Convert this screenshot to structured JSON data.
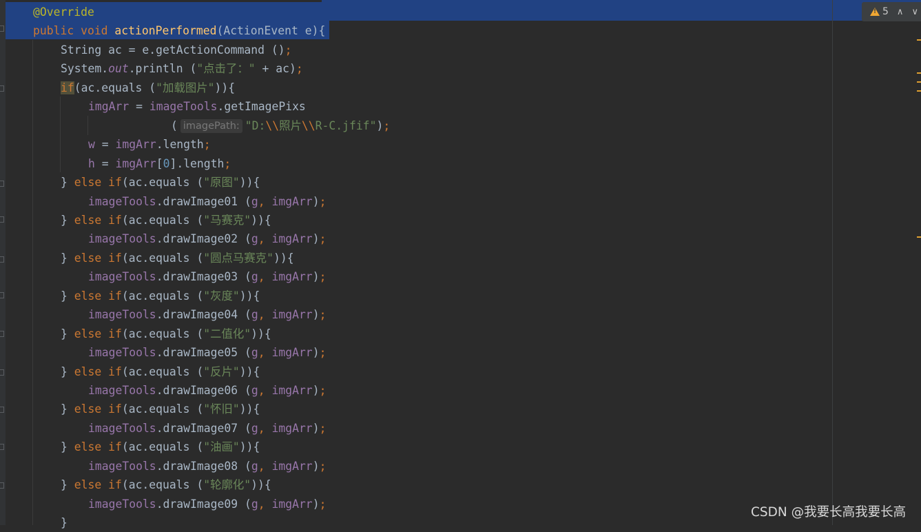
{
  "editor": {
    "lines": [
      {
        "indent": 0,
        "tokens": [
          {
            "t": "@Override",
            "c": "ann"
          }
        ]
      },
      {
        "indent": 0,
        "tokens": [
          {
            "t": "public ",
            "c": "kw"
          },
          {
            "t": "void ",
            "c": "kw"
          },
          {
            "t": "actionPerformed",
            "c": "fn"
          },
          {
            "t": "(ActionEvent e){",
            "c": ""
          }
        ]
      },
      {
        "indent": 1,
        "tokens": [
          {
            "t": "String ac = e.getActionCommand ()",
            "c": ""
          },
          {
            "t": ";",
            "c": "punc"
          }
        ]
      },
      {
        "indent": 1,
        "tokens": [
          {
            "t": "System.",
            "c": ""
          },
          {
            "t": "out",
            "c": "static"
          },
          {
            "t": ".println (",
            "c": ""
          },
          {
            "t": "\"点击了：\"",
            "c": "str"
          },
          {
            "t": " + ac)",
            "c": ""
          },
          {
            "t": ";",
            "c": "punc"
          }
        ]
      },
      {
        "indent": 1,
        "tokens": [
          {
            "t": "if",
            "c": "kw hl"
          },
          {
            "t": "(ac.equals (",
            "c": ""
          },
          {
            "t": "\"加载图片\"",
            "c": "str"
          },
          {
            "t": ")){",
            "c": ""
          }
        ]
      },
      {
        "indent": 2,
        "tokens": [
          {
            "t": "imgArr",
            "c": "field"
          },
          {
            "t": " = ",
            "c": ""
          },
          {
            "t": "imageTools",
            "c": "field"
          },
          {
            "t": ".getImagePixs",
            "c": ""
          }
        ]
      },
      {
        "indent": 5,
        "tokens": [
          {
            "t": "(",
            "c": ""
          },
          {
            "t": "imagePath:",
            "c": "hint"
          },
          {
            "t": "\"D:",
            "c": "str"
          },
          {
            "t": "\\\\",
            "c": "esc"
          },
          {
            "t": "照片",
            "c": "str"
          },
          {
            "t": "\\\\",
            "c": "esc"
          },
          {
            "t": "R-C.jfif\"",
            "c": "str"
          },
          {
            "t": ")",
            "c": ""
          },
          {
            "t": ";",
            "c": "punc"
          }
        ]
      },
      {
        "indent": 2,
        "tokens": [
          {
            "t": "w",
            "c": "field"
          },
          {
            "t": " = ",
            "c": ""
          },
          {
            "t": "imgArr",
            "c": "field"
          },
          {
            "t": ".length",
            "c": ""
          },
          {
            "t": ";",
            "c": "punc"
          }
        ]
      },
      {
        "indent": 2,
        "tokens": [
          {
            "t": "h",
            "c": "field"
          },
          {
            "t": " = ",
            "c": ""
          },
          {
            "t": "imgArr",
            "c": "field"
          },
          {
            "t": "[",
            "c": ""
          },
          {
            "t": "0",
            "c": "num"
          },
          {
            "t": "].length",
            "c": ""
          },
          {
            "t": ";",
            "c": "punc"
          }
        ]
      },
      {
        "indent": 1,
        "tokens": [
          {
            "t": "} ",
            "c": ""
          },
          {
            "t": "else if",
            "c": "kw"
          },
          {
            "t": "(ac.equals (",
            "c": ""
          },
          {
            "t": "\"原图\"",
            "c": "str"
          },
          {
            "t": ")){",
            "c": ""
          }
        ]
      },
      {
        "indent": 2,
        "tokens": [
          {
            "t": "imageTools",
            "c": "field"
          },
          {
            "t": ".drawImage01 (",
            "c": ""
          },
          {
            "t": "g",
            "c": "field"
          },
          {
            "t": ", ",
            "c": "punc"
          },
          {
            "t": "imgArr",
            "c": "field"
          },
          {
            "t": ")",
            "c": ""
          },
          {
            "t": ";",
            "c": "punc"
          }
        ]
      },
      {
        "indent": 1,
        "tokens": [
          {
            "t": "} ",
            "c": ""
          },
          {
            "t": "else if",
            "c": "kw"
          },
          {
            "t": "(ac.equals (",
            "c": ""
          },
          {
            "t": "\"马赛克\"",
            "c": "str"
          },
          {
            "t": ")){",
            "c": ""
          }
        ]
      },
      {
        "indent": 2,
        "tokens": [
          {
            "t": "imageTools",
            "c": "field"
          },
          {
            "t": ".drawImage02 (",
            "c": ""
          },
          {
            "t": "g",
            "c": "field"
          },
          {
            "t": ", ",
            "c": "punc"
          },
          {
            "t": "imgArr",
            "c": "field"
          },
          {
            "t": ")",
            "c": ""
          },
          {
            "t": ";",
            "c": "punc"
          }
        ]
      },
      {
        "indent": 1,
        "tokens": [
          {
            "t": "} ",
            "c": ""
          },
          {
            "t": "else if",
            "c": "kw"
          },
          {
            "t": "(ac.equals (",
            "c": ""
          },
          {
            "t": "\"圆点马赛克\"",
            "c": "str"
          },
          {
            "t": ")){",
            "c": ""
          }
        ]
      },
      {
        "indent": 2,
        "tokens": [
          {
            "t": "imageTools",
            "c": "field"
          },
          {
            "t": ".drawImage03 (",
            "c": ""
          },
          {
            "t": "g",
            "c": "field"
          },
          {
            "t": ", ",
            "c": "punc"
          },
          {
            "t": "imgArr",
            "c": "field"
          },
          {
            "t": ")",
            "c": ""
          },
          {
            "t": ";",
            "c": "punc"
          }
        ]
      },
      {
        "indent": 1,
        "tokens": [
          {
            "t": "} ",
            "c": ""
          },
          {
            "t": "else if",
            "c": "kw"
          },
          {
            "t": "(ac.equals (",
            "c": ""
          },
          {
            "t": "\"灰度\"",
            "c": "str"
          },
          {
            "t": ")){",
            "c": ""
          }
        ]
      },
      {
        "indent": 2,
        "tokens": [
          {
            "t": "imageTools",
            "c": "field"
          },
          {
            "t": ".drawImage04 (",
            "c": ""
          },
          {
            "t": "g",
            "c": "field"
          },
          {
            "t": ", ",
            "c": "punc"
          },
          {
            "t": "imgArr",
            "c": "field"
          },
          {
            "t": ")",
            "c": ""
          },
          {
            "t": ";",
            "c": "punc"
          }
        ]
      },
      {
        "indent": 1,
        "tokens": [
          {
            "t": "} ",
            "c": ""
          },
          {
            "t": "else if",
            "c": "kw"
          },
          {
            "t": "(ac.equals (",
            "c": ""
          },
          {
            "t": "\"二值化\"",
            "c": "str"
          },
          {
            "t": ")){",
            "c": ""
          }
        ]
      },
      {
        "indent": 2,
        "tokens": [
          {
            "t": "imageTools",
            "c": "field"
          },
          {
            "t": ".drawImage05 (",
            "c": ""
          },
          {
            "t": "g",
            "c": "field"
          },
          {
            "t": ", ",
            "c": "punc"
          },
          {
            "t": "imgArr",
            "c": "field"
          },
          {
            "t": ")",
            "c": ""
          },
          {
            "t": ";",
            "c": "punc"
          }
        ]
      },
      {
        "indent": 1,
        "tokens": [
          {
            "t": "} ",
            "c": ""
          },
          {
            "t": "else if",
            "c": "kw"
          },
          {
            "t": "(ac.equals (",
            "c": ""
          },
          {
            "t": "\"反片\"",
            "c": "str"
          },
          {
            "t": ")){",
            "c": ""
          }
        ]
      },
      {
        "indent": 2,
        "tokens": [
          {
            "t": "imageTools",
            "c": "field"
          },
          {
            "t": ".drawImage06 (",
            "c": ""
          },
          {
            "t": "g",
            "c": "field"
          },
          {
            "t": ", ",
            "c": "punc"
          },
          {
            "t": "imgArr",
            "c": "field"
          },
          {
            "t": ")",
            "c": ""
          },
          {
            "t": ";",
            "c": "punc"
          }
        ]
      },
      {
        "indent": 1,
        "tokens": [
          {
            "t": "} ",
            "c": ""
          },
          {
            "t": "else if",
            "c": "kw"
          },
          {
            "t": "(ac.equals (",
            "c": ""
          },
          {
            "t": "\"怀旧\"",
            "c": "str"
          },
          {
            "t": ")){",
            "c": ""
          }
        ]
      },
      {
        "indent": 2,
        "tokens": [
          {
            "t": "imageTools",
            "c": "field"
          },
          {
            "t": ".drawImage07 (",
            "c": ""
          },
          {
            "t": "g",
            "c": "field"
          },
          {
            "t": ", ",
            "c": "punc"
          },
          {
            "t": "imgArr",
            "c": "field"
          },
          {
            "t": ")",
            "c": ""
          },
          {
            "t": ";",
            "c": "punc"
          }
        ]
      },
      {
        "indent": 1,
        "tokens": [
          {
            "t": "} ",
            "c": ""
          },
          {
            "t": "else if",
            "c": "kw"
          },
          {
            "t": "(ac.equals (",
            "c": ""
          },
          {
            "t": "\"油画\"",
            "c": "str"
          },
          {
            "t": ")){",
            "c": ""
          }
        ]
      },
      {
        "indent": 2,
        "tokens": [
          {
            "t": "imageTools",
            "c": "field"
          },
          {
            "t": ".drawImage08 (",
            "c": ""
          },
          {
            "t": "g",
            "c": "field"
          },
          {
            "t": ", ",
            "c": "punc"
          },
          {
            "t": "imgArr",
            "c": "field"
          },
          {
            "t": ")",
            "c": ""
          },
          {
            "t": ";",
            "c": "punc"
          }
        ]
      },
      {
        "indent": 1,
        "tokens": [
          {
            "t": "} ",
            "c": ""
          },
          {
            "t": "else if",
            "c": "kw"
          },
          {
            "t": "(ac.equals (",
            "c": ""
          },
          {
            "t": "\"轮廓化\"",
            "c": "str"
          },
          {
            "t": ")){",
            "c": ""
          }
        ]
      },
      {
        "indent": 2,
        "tokens": [
          {
            "t": "imageTools",
            "c": "field"
          },
          {
            "t": ".drawImage09 (",
            "c": ""
          },
          {
            "t": "g",
            "c": "field"
          },
          {
            "t": ", ",
            "c": "punc"
          },
          {
            "t": "imgArr",
            "c": "field"
          },
          {
            "t": ")",
            "c": ""
          },
          {
            "t": ";",
            "c": "punc"
          }
        ]
      },
      {
        "indent": 1,
        "tokens": [
          {
            "t": "}",
            "c": ""
          }
        ]
      }
    ]
  },
  "inspection_widget": {
    "icon": "warning-triangle-icon",
    "count": "5",
    "prev_icon": "chevron-up-icon",
    "next_icon": "chevron-down-icon"
  },
  "watermark": "CSDN @我要长高我要长高",
  "colors": {
    "background": "#2b2b2b",
    "selection": "#214283",
    "keyword": "#cc7832",
    "string": "#6a8759",
    "field": "#9876aa",
    "method_decl": "#ffc66d",
    "annotation": "#bbb529",
    "number": "#6897bb",
    "default_text": "#a9b7c6"
  }
}
